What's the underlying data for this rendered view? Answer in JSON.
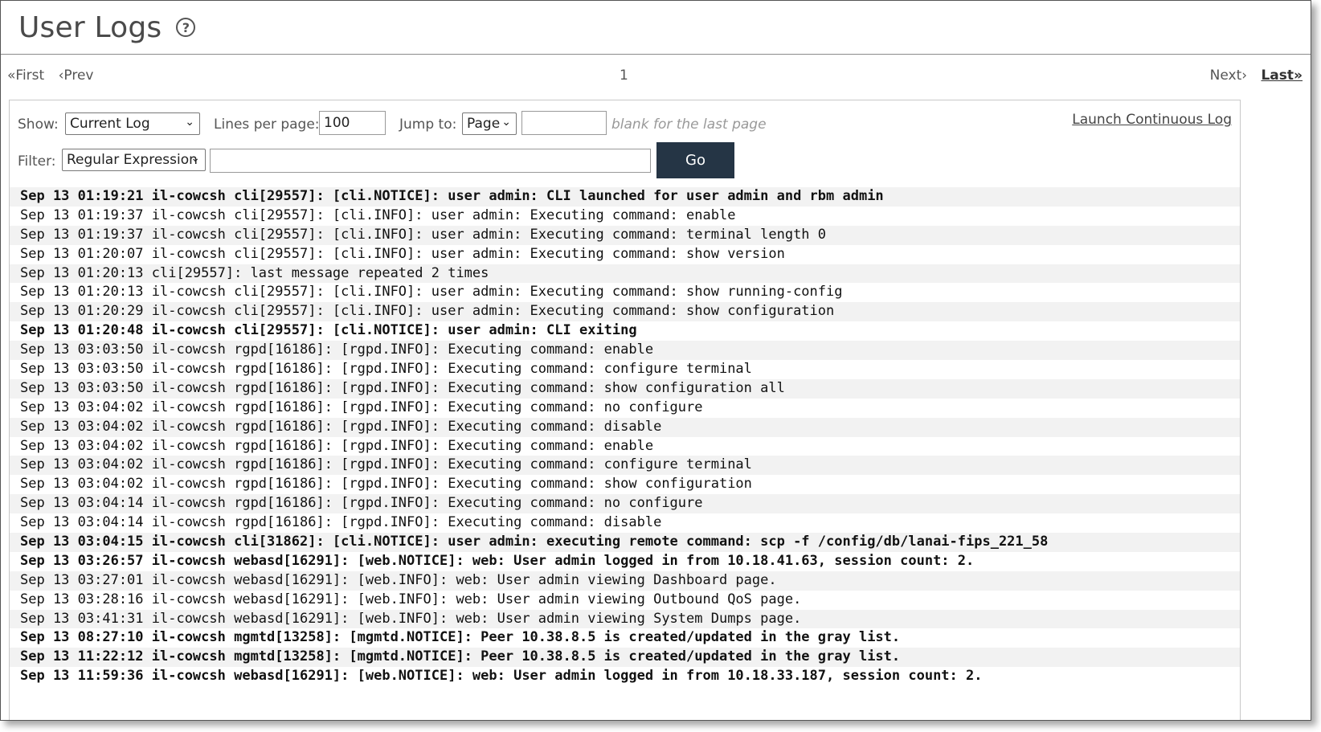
{
  "header": {
    "title": "User Logs",
    "help_icon": "question-circle-icon"
  },
  "pager": {
    "first": "«First",
    "prev": "‹Prev",
    "current_page": "1",
    "next": "Next›",
    "last": "Last»"
  },
  "controls": {
    "show_label": "Show:",
    "show_value": "Current Log",
    "lines_label": "Lines per page:",
    "lines_value": "100",
    "jump_label": "Jump to:",
    "jump_value": "Page",
    "jump_input_value": "",
    "jump_hint": "blank for the last page",
    "launch_link": "Launch Continuous Log",
    "filter_label": "Filter:",
    "filter_type": "Regular Expression",
    "filter_value": "",
    "go_label": "Go"
  },
  "log": [
    {
      "text": "Sep 13 01:19:21 il-cowcsh cli[29557]: [cli.NOTICE]: user admin: CLI launched for user admin and rbm admin",
      "bold": true
    },
    {
      "text": "Sep 13 01:19:37 il-cowcsh cli[29557]: [cli.INFO]: user admin: Executing command: enable",
      "bold": false
    },
    {
      "text": "Sep 13 01:19:37 il-cowcsh cli[29557]: [cli.INFO]: user admin: Executing command: terminal length 0",
      "bold": false
    },
    {
      "text": "Sep 13 01:20:07 il-cowcsh cli[29557]: [cli.INFO]: user admin: Executing command: show version",
      "bold": false
    },
    {
      "text": "Sep 13 01:20:13 cli[29557]: last message repeated 2 times",
      "bold": false
    },
    {
      "text": "Sep 13 01:20:13 il-cowcsh cli[29557]: [cli.INFO]: user admin: Executing command: show running-config",
      "bold": false
    },
    {
      "text": "Sep 13 01:20:29 il-cowcsh cli[29557]: [cli.INFO]: user admin: Executing command: show configuration",
      "bold": false
    },
    {
      "text": "Sep 13 01:20:48 il-cowcsh cli[29557]: [cli.NOTICE]: user admin: CLI exiting",
      "bold": true
    },
    {
      "text": "Sep 13 03:03:50 il-cowcsh rgpd[16186]: [rgpd.INFO]: Executing command: enable",
      "bold": false
    },
    {
      "text": "Sep 13 03:03:50 il-cowcsh rgpd[16186]: [rgpd.INFO]: Executing command: configure terminal",
      "bold": false
    },
    {
      "text": "Sep 13 03:03:50 il-cowcsh rgpd[16186]: [rgpd.INFO]: Executing command: show configuration all",
      "bold": false
    },
    {
      "text": "Sep 13 03:04:02 il-cowcsh rgpd[16186]: [rgpd.INFO]: Executing command: no configure",
      "bold": false
    },
    {
      "text": "Sep 13 03:04:02 il-cowcsh rgpd[16186]: [rgpd.INFO]: Executing command: disable",
      "bold": false
    },
    {
      "text": "Sep 13 03:04:02 il-cowcsh rgpd[16186]: [rgpd.INFO]: Executing command: enable",
      "bold": false
    },
    {
      "text": "Sep 13 03:04:02 il-cowcsh rgpd[16186]: [rgpd.INFO]: Executing command: configure terminal",
      "bold": false
    },
    {
      "text": "Sep 13 03:04:02 il-cowcsh rgpd[16186]: [rgpd.INFO]: Executing command: show configuration",
      "bold": false
    },
    {
      "text": "Sep 13 03:04:14 il-cowcsh rgpd[16186]: [rgpd.INFO]: Executing command: no configure",
      "bold": false
    },
    {
      "text": "Sep 13 03:04:14 il-cowcsh rgpd[16186]: [rgpd.INFO]: Executing command: disable",
      "bold": false
    },
    {
      "text": "Sep 13 03:04:15 il-cowcsh cli[31862]: [cli.NOTICE]: user admin: executing remote command: scp -f /config/db/lanai-fips_221_58",
      "bold": true
    },
    {
      "text": "Sep 13 03:26:57 il-cowcsh webasd[16291]: [web.NOTICE]: web: User admin logged in from 10.18.41.63, session count: 2.",
      "bold": true
    },
    {
      "text": "Sep 13 03:27:01 il-cowcsh webasd[16291]: [web.INFO]: web: User admin viewing Dashboard page.",
      "bold": false
    },
    {
      "text": "Sep 13 03:28:16 il-cowcsh webasd[16291]: [web.INFO]: web: User admin viewing Outbound QoS page.",
      "bold": false
    },
    {
      "text": "Sep 13 03:41:31 il-cowcsh webasd[16291]: [web.INFO]: web: User admin viewing System Dumps page.",
      "bold": false
    },
    {
      "text": "Sep 13 08:27:10 il-cowcsh mgmtd[13258]: [mgmtd.NOTICE]: Peer 10.38.8.5 is created/updated in the gray list.",
      "bold": true
    },
    {
      "text": "Sep 13 11:22:12 il-cowcsh mgmtd[13258]: [mgmtd.NOTICE]: Peer 10.38.8.5 is created/updated in the gray list.",
      "bold": true
    },
    {
      "text": "Sep 13 11:59:36 il-cowcsh webasd[16291]: [web.NOTICE]: web: User admin logged in from 10.18.33.187, session count: 2.",
      "bold": true
    }
  ]
}
